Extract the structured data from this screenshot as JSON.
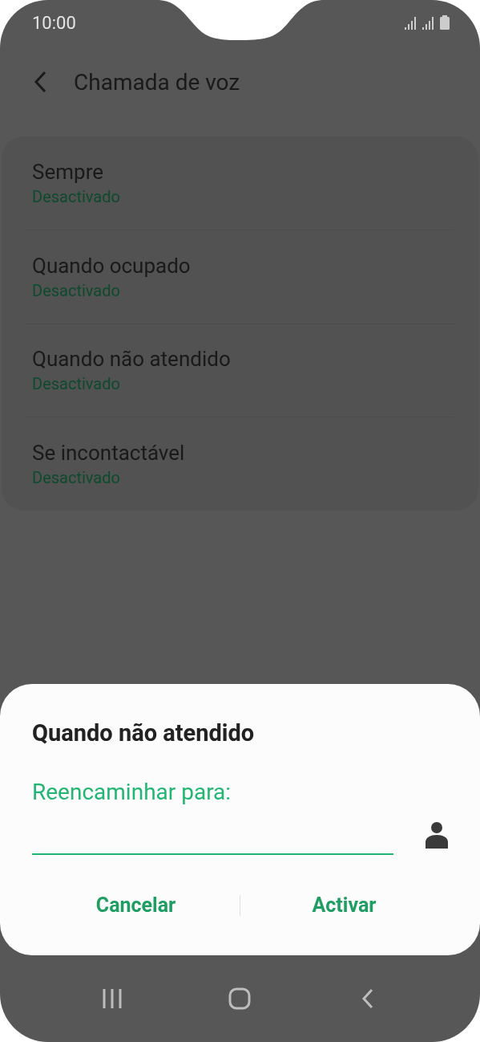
{
  "status_bar": {
    "time": "10:00"
  },
  "header": {
    "title": "Chamada de voz"
  },
  "options": [
    {
      "title": "Sempre",
      "status": "Desactivado"
    },
    {
      "title": "Quando ocupado",
      "status": "Desactivado"
    },
    {
      "title": "Quando não atendido",
      "status": "Desactivado"
    },
    {
      "title": "Se incontactável",
      "status": "Desactivado"
    }
  ],
  "dialog": {
    "title": "Quando não atendido",
    "field_label": "Reencaminhar para:",
    "buttons": [
      "Cancelar",
      "Activar"
    ]
  }
}
